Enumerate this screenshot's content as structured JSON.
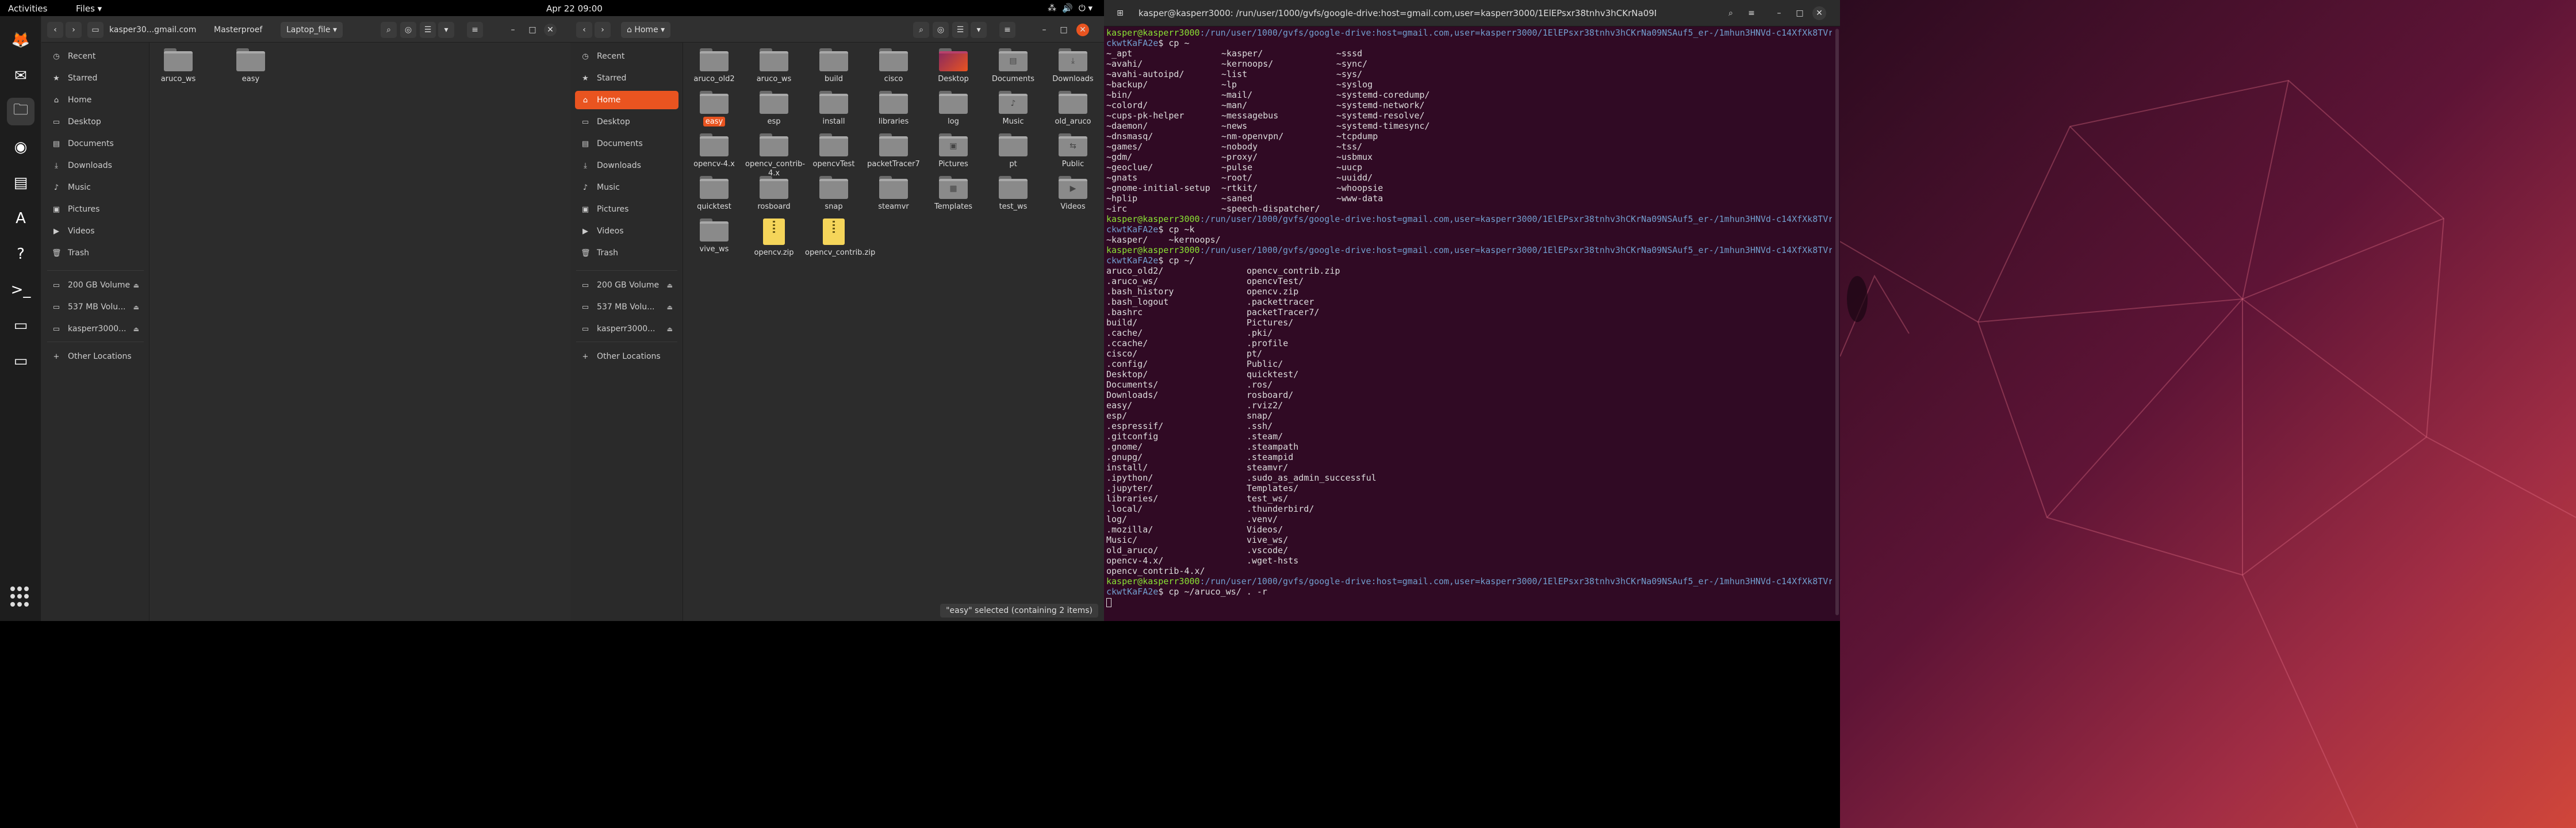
{
  "topbar": {
    "activities": "Activities",
    "app_menu": "Files ▾",
    "clock": "Apr 22  09:00",
    "tray": [
      "⁂",
      "🔊",
      "⏻ ▾"
    ]
  },
  "dock": {
    "items": [
      {
        "name": "firefox-icon",
        "glyph": "🦊"
      },
      {
        "name": "thunderbird-icon",
        "glyph": "✉"
      },
      {
        "name": "files-icon",
        "glyph": "🗀"
      },
      {
        "name": "rhythmbox-icon",
        "glyph": "◉"
      },
      {
        "name": "writer-icon",
        "glyph": "▤"
      },
      {
        "name": "software-icon",
        "glyph": "A"
      },
      {
        "name": "help-icon",
        "glyph": "?"
      },
      {
        "name": "terminal-icon",
        "glyph": ">_"
      },
      {
        "name": "drive-icon",
        "glyph": "▭"
      },
      {
        "name": "drive2-icon",
        "glyph": "▭"
      }
    ]
  },
  "fm_left": {
    "breadcrumbs": [
      "kasper30...gmail.com",
      "Masterproef",
      "Laptop_file"
    ],
    "sidebar": [
      "Recent",
      "Starred",
      "Home",
      "Desktop",
      "Documents",
      "Downloads",
      "Music",
      "Pictures",
      "Videos",
      "Trash"
    ],
    "volumes": [
      "200 GB Volume",
      "537 MB Volu...",
      "kasperr3000..."
    ],
    "other": "Other Locations",
    "files": [
      "aruco_ws",
      "easy"
    ]
  },
  "fm_right": {
    "location": "Home",
    "sidebar": [
      "Recent",
      "Starred",
      "Home",
      "Desktop",
      "Documents",
      "Downloads",
      "Music",
      "Pictures",
      "Videos",
      "Trash"
    ],
    "volumes": [
      "200 GB Volume",
      "537 MB Volu...",
      "kasperr3000..."
    ],
    "other": "Other Locations",
    "files": [
      "aruco_old2",
      "aruco_ws",
      "build",
      "cisco",
      "Desktop",
      "Documents",
      "Downloads",
      "easy",
      "esp",
      "install",
      "libraries",
      "log",
      "Music",
      "old_aruco",
      "opencv-4.x",
      "opencv_contrib-4.x",
      "opencvTest",
      "packetTracer7",
      "Pictures",
      "pt",
      "Public",
      "quicktest",
      "rosboard",
      "snap",
      "steamvr",
      "Templates",
      "test_ws",
      "Videos",
      "vive_ws",
      "opencv.zip",
      "opencv_contrib.zip"
    ],
    "status": "\"easy\" selected  (containing 2 items)"
  },
  "terminal": {
    "title": "kasper@kasperr3000: /run/user/1000/gvfs/google-drive:host=gmail.com,user=kasperr3000/1ElEPsxr38tnhv3hCKrNa09NSAuf5_er-/1mhun...",
    "prompt_user": "kasper@kasperr3000",
    "prompt_path": ":/run/user/1000/gvfs/google-drive:host=gmail.com,user=kasperr3000/1ElEPsxr38tnhv3hCKrNa09NSAuf5_er-/1mhun3HNVd-c14XfXk8TVr",
    "prompt_path2": "ckwtKaFA2e",
    "cmd1": "$ cp ~",
    "ls1": [
      [
        "~_apt",
        "~kasper/",
        "~sssd"
      ],
      [
        "~avahi/",
        "~kernoops/",
        "~sync/"
      ],
      [
        "~avahi-autoipd/",
        "~list",
        "~sys/"
      ],
      [
        "~backup/",
        "~lp",
        "~syslog"
      ],
      [
        "~bin/",
        "~mail/",
        "~systemd-coredump/"
      ],
      [
        "~colord/",
        "~man/",
        "~systemd-network/"
      ],
      [
        "~cups-pk-helper",
        "~messagebus",
        "~systemd-resolve/"
      ],
      [
        "~daemon/",
        "~news",
        "~systemd-timesync/"
      ],
      [
        "~dnsmasq/",
        "~nm-openvpn/",
        "~tcpdump"
      ],
      [
        "~games/",
        "~nobody",
        "~tss/"
      ],
      [
        "~gdm/",
        "~proxy/",
        "~usbmux"
      ],
      [
        "~geoclue/",
        "~pulse",
        "~uucp"
      ],
      [
        "~gnats",
        "~root/",
        "~uuidd/"
      ],
      [
        "~gnome-initial-setup",
        "~rtkit/",
        "~whoopsie"
      ],
      [
        "~hplip",
        "~saned",
        "~www-data"
      ],
      [
        "~irc",
        "~speech-dispatcher/",
        ""
      ]
    ],
    "cmd2": "$ cp ~k",
    "ls2": [
      "~kasper/    ~kernoops/"
    ],
    "cmd3": "$ cp ~/",
    "ls3": [
      [
        "aruco_old2/",
        "opencv_contrib.zip"
      ],
      [
        ".aruco_ws/",
        "opencvTest/"
      ],
      [
        ".bash_history",
        "opencv.zip"
      ],
      [
        ".bash_logout",
        ".packettracer"
      ],
      [
        ".bashrc",
        "packetTracer7/"
      ],
      [
        "build/",
        "Pictures/"
      ],
      [
        ".cache/",
        ".pki/"
      ],
      [
        ".ccache/",
        ".profile"
      ],
      [
        "cisco/",
        "pt/"
      ],
      [
        ".config/",
        "Public/"
      ],
      [
        "Desktop/",
        "quicktest/"
      ],
      [
        "Documents/",
        ".ros/"
      ],
      [
        "Downloads/",
        "rosboard/"
      ],
      [
        "easy/",
        ".rviz2/"
      ],
      [
        "esp/",
        "snap/"
      ],
      [
        ".espressif/",
        ".ssh/"
      ],
      [
        ".gitconfig",
        ".steam/"
      ],
      [
        ".gnome/",
        ".steampath"
      ],
      [
        ".gnupg/",
        ".steampid"
      ],
      [
        "install/",
        "steamvr/"
      ],
      [
        ".ipython/",
        ".sudo_as_admin_successful"
      ],
      [
        ".jupyter/",
        "Templates/"
      ],
      [
        "libraries/",
        "test_ws/"
      ],
      [
        ".local/",
        ".thunderbird/"
      ],
      [
        "log/",
        ".venv/"
      ],
      [
        ".mozilla/",
        "Videos/"
      ],
      [
        "Music/",
        "vive_ws/"
      ],
      [
        "old_aruco/",
        ".vscode/"
      ],
      [
        "opencv-4.x/",
        ".wget-hsts"
      ],
      [
        "opencv_contrib-4.x/",
        ""
      ]
    ],
    "cmd4": "$ cp ~/aruco_ws/ . -r"
  },
  "colors": {
    "accent": "#e95420",
    "terminal_bg": "#300a24",
    "prompt_user": "#8ae234",
    "prompt_path": "#729fcf"
  }
}
